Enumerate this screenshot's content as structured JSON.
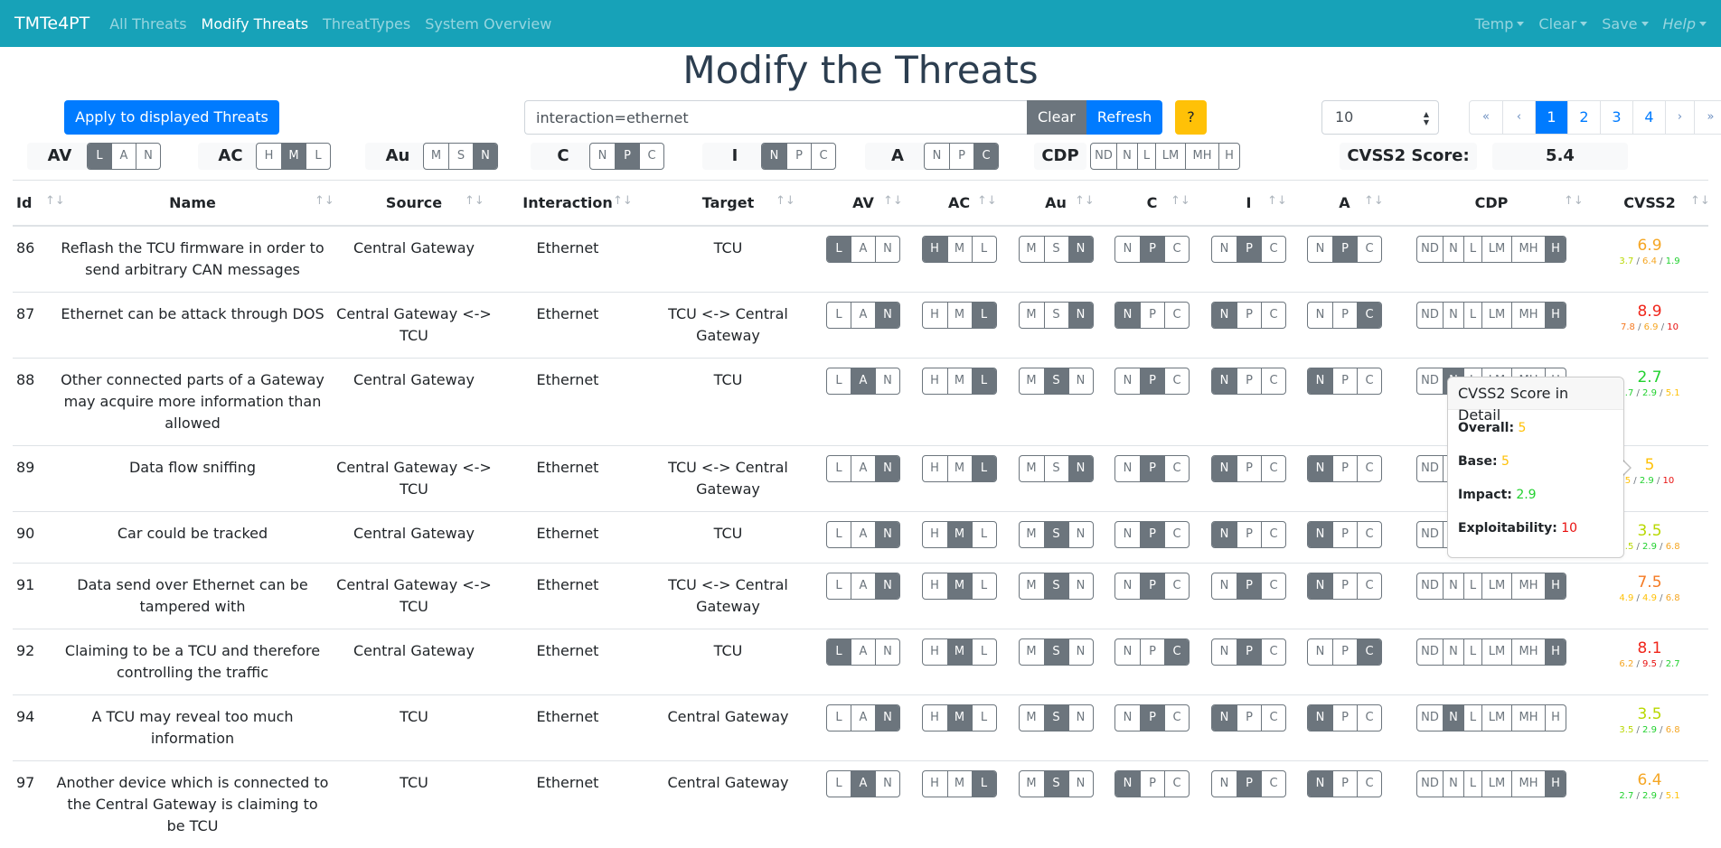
{
  "navbar": {
    "brand": "TMTe4PT",
    "links": [
      {
        "label": "All Threats",
        "active": false
      },
      {
        "label": "Modify Threats",
        "active": true
      },
      {
        "label": "ThreatTypes",
        "active": false
      },
      {
        "label": "System Overview",
        "active": false
      }
    ],
    "dropdowns": [
      {
        "label": "Temp",
        "italic": false
      },
      {
        "label": "Clear",
        "italic": false
      },
      {
        "label": "Save",
        "italic": false
      },
      {
        "label": "Help",
        "italic": true
      }
    ]
  },
  "page_title": "Modify the Threats",
  "toolbar": {
    "apply_label": "Apply to displayed Threats",
    "search_value": "interaction=ethernet",
    "clear_label": "Clear",
    "refresh_label": "Refresh",
    "help_label": "?",
    "page_size": "10",
    "pagination": [
      "«",
      "‹",
      "1",
      "2",
      "3",
      "4",
      "›",
      "»"
    ],
    "current_page": "1"
  },
  "filters": {
    "AV": {
      "label": "AV",
      "options": [
        "L",
        "A",
        "N"
      ],
      "selected": "L"
    },
    "AC": {
      "label": "AC",
      "options": [
        "H",
        "M",
        "L"
      ],
      "selected": "M"
    },
    "Au": {
      "label": "Au",
      "options": [
        "M",
        "S",
        "N"
      ],
      "selected": "N"
    },
    "C": {
      "label": "C",
      "options": [
        "N",
        "P",
        "C"
      ],
      "selected": "P"
    },
    "I": {
      "label": "I",
      "options": [
        "N",
        "P",
        "C"
      ],
      "selected": "N"
    },
    "A": {
      "label": "A",
      "options": [
        "N",
        "P",
        "C"
      ],
      "selected": "C"
    },
    "CDP": {
      "label": "CDP",
      "options": [
        "ND",
        "N",
        "L",
        "LM",
        "MH",
        "H"
      ],
      "selected": ""
    },
    "score_label": "CVSS2 Score:",
    "score_value": "5.4"
  },
  "table": {
    "columns": [
      "Id",
      "Name",
      "Source",
      "Interaction",
      "Target",
      "AV",
      "AC",
      "Au",
      "C",
      "I",
      "A",
      "CDP",
      "CVSS2"
    ],
    "rows": [
      {
        "id": "86",
        "name": "Reflash the TCU firmware in order to send arbitrary CAN messages",
        "source": "Central Gateway",
        "interaction": "Ethernet",
        "target": "TCU",
        "av": "L",
        "ac": "H",
        "au": "N",
        "c": "P",
        "i": "P",
        "a": "P",
        "cdp": "H",
        "score": "6.9",
        "score_color": "#f5a623",
        "sub": [
          [
            "3.7",
            "#b8d800"
          ],
          [
            "6.4",
            "#f5a623"
          ],
          [
            "1.9",
            "#22d12f"
          ]
        ]
      },
      {
        "id": "87",
        "name": "Ethernet can be attack through DOS",
        "source": "Central Gateway <-> TCU",
        "interaction": "Ethernet",
        "target": "TCU <-> Central Gateway",
        "av": "N",
        "ac": "L",
        "au": "N",
        "c": "N",
        "i": "N",
        "a": "C",
        "cdp": "H",
        "score": "8.9",
        "score_color": "#f0261b",
        "sub": [
          [
            "7.8",
            "#f57a23"
          ],
          [
            "6.9",
            "#f5a623"
          ],
          [
            "10",
            "#e8100f"
          ]
        ]
      },
      {
        "id": "88",
        "name": "Other connected parts of a Gateway may acquire more information than allowed",
        "source": "Central Gateway",
        "interaction": "Ethernet",
        "target": "TCU",
        "av": "A",
        "ac": "L",
        "au": "S",
        "c": "P",
        "i": "N",
        "a": "N",
        "cdp": "N",
        "score": "2.7",
        "score_color": "#22d12f",
        "sub": [
          [
            "2.7",
            "#22d12f"
          ],
          [
            "2.9",
            "#22d12f"
          ],
          [
            "5.1",
            "#ffc107"
          ]
        ]
      },
      {
        "id": "89",
        "name": "Data flow sniffing",
        "source": "Central Gateway <-> TCU",
        "interaction": "Ethernet",
        "target": "TCU <-> Central Gateway",
        "av": "N",
        "ac": "L",
        "au": "N",
        "c": "P",
        "i": "N",
        "a": "N",
        "cdp": "",
        "score": "5",
        "score_color": "#ffc107",
        "sub": [
          [
            "5",
            "#ffc107"
          ],
          [
            "2.9",
            "#22d12f"
          ],
          [
            "10",
            "#e8100f"
          ]
        ]
      },
      {
        "id": "90",
        "name": "Car could be tracked",
        "source": "Central Gateway",
        "interaction": "Ethernet",
        "target": "TCU",
        "av": "N",
        "ac": "M",
        "au": "S",
        "c": "P",
        "i": "N",
        "a": "N",
        "cdp": "",
        "score": "3.5",
        "score_color": "#b8d800",
        "sub": [
          [
            "3.5",
            "#b8d800"
          ],
          [
            "2.9",
            "#22d12f"
          ],
          [
            "6.8",
            "#f5a623"
          ]
        ]
      },
      {
        "id": "91",
        "name": "Data send over Ethernet can be tampered with",
        "source": "Central Gateway <-> TCU",
        "interaction": "Ethernet",
        "target": "TCU <-> Central Gateway",
        "av": "N",
        "ac": "M",
        "au": "S",
        "c": "P",
        "i": "P",
        "a": "N",
        "cdp": "H",
        "score": "7.5",
        "score_color": "#f57a23",
        "sub": [
          [
            "4.9",
            "#ffc107"
          ],
          [
            "4.9",
            "#ffc107"
          ],
          [
            "6.8",
            "#f5a623"
          ]
        ]
      },
      {
        "id": "92",
        "name": "Claiming to be a TCU and therefore controlling the traffic",
        "source": "Central Gateway",
        "interaction": "Ethernet",
        "target": "TCU",
        "av": "L",
        "ac": "M",
        "au": "S",
        "c": "C",
        "i": "P",
        "a": "C",
        "cdp": "H",
        "score": "8.1",
        "score_color": "#f0261b",
        "sub": [
          [
            "6.2",
            "#f5a623"
          ],
          [
            "9.5",
            "#e8100f"
          ],
          [
            "2.7",
            "#22d12f"
          ]
        ]
      },
      {
        "id": "94",
        "name": "A TCU may reveal too much information",
        "source": "TCU",
        "interaction": "Ethernet",
        "target": "Central Gateway",
        "av": "N",
        "ac": "M",
        "au": "S",
        "c": "P",
        "i": "N",
        "a": "N",
        "cdp": "N",
        "score": "3.5",
        "score_color": "#b8d800",
        "sub": [
          [
            "3.5",
            "#b8d800"
          ],
          [
            "2.9",
            "#22d12f"
          ],
          [
            "6.8",
            "#f5a623"
          ]
        ]
      },
      {
        "id": "97",
        "name": "Another device which is connected to the Central Gateway is claiming to be TCU",
        "source": "TCU",
        "interaction": "Ethernet",
        "target": "Central Gateway",
        "av": "A",
        "ac": "L",
        "au": "S",
        "c": "N",
        "i": "P",
        "a": "N",
        "cdp": "H",
        "score": "6.4",
        "score_color": "#f5a623",
        "sub": [
          [
            "2.7",
            "#22d12f"
          ],
          [
            "2.9",
            "#22d12f"
          ],
          [
            "5.1",
            "#ffc107"
          ]
        ]
      }
    ]
  },
  "popover": {
    "title": "CVSS2 Score in Detail",
    "items": [
      {
        "label": "Overall:",
        "value": "5",
        "color": "#ffc107"
      },
      {
        "label": "Base:",
        "value": "5",
        "color": "#ffc107"
      },
      {
        "label": "Impact:",
        "value": "2.9",
        "color": "#22d12f"
      },
      {
        "label": "Exploitability:",
        "value": "10",
        "color": "#e8100f"
      }
    ]
  },
  "colors": {
    "navbar": "#17a2b8",
    "primary": "#007bff",
    "secondary": "#6c757d",
    "warning": "#ffc107"
  }
}
